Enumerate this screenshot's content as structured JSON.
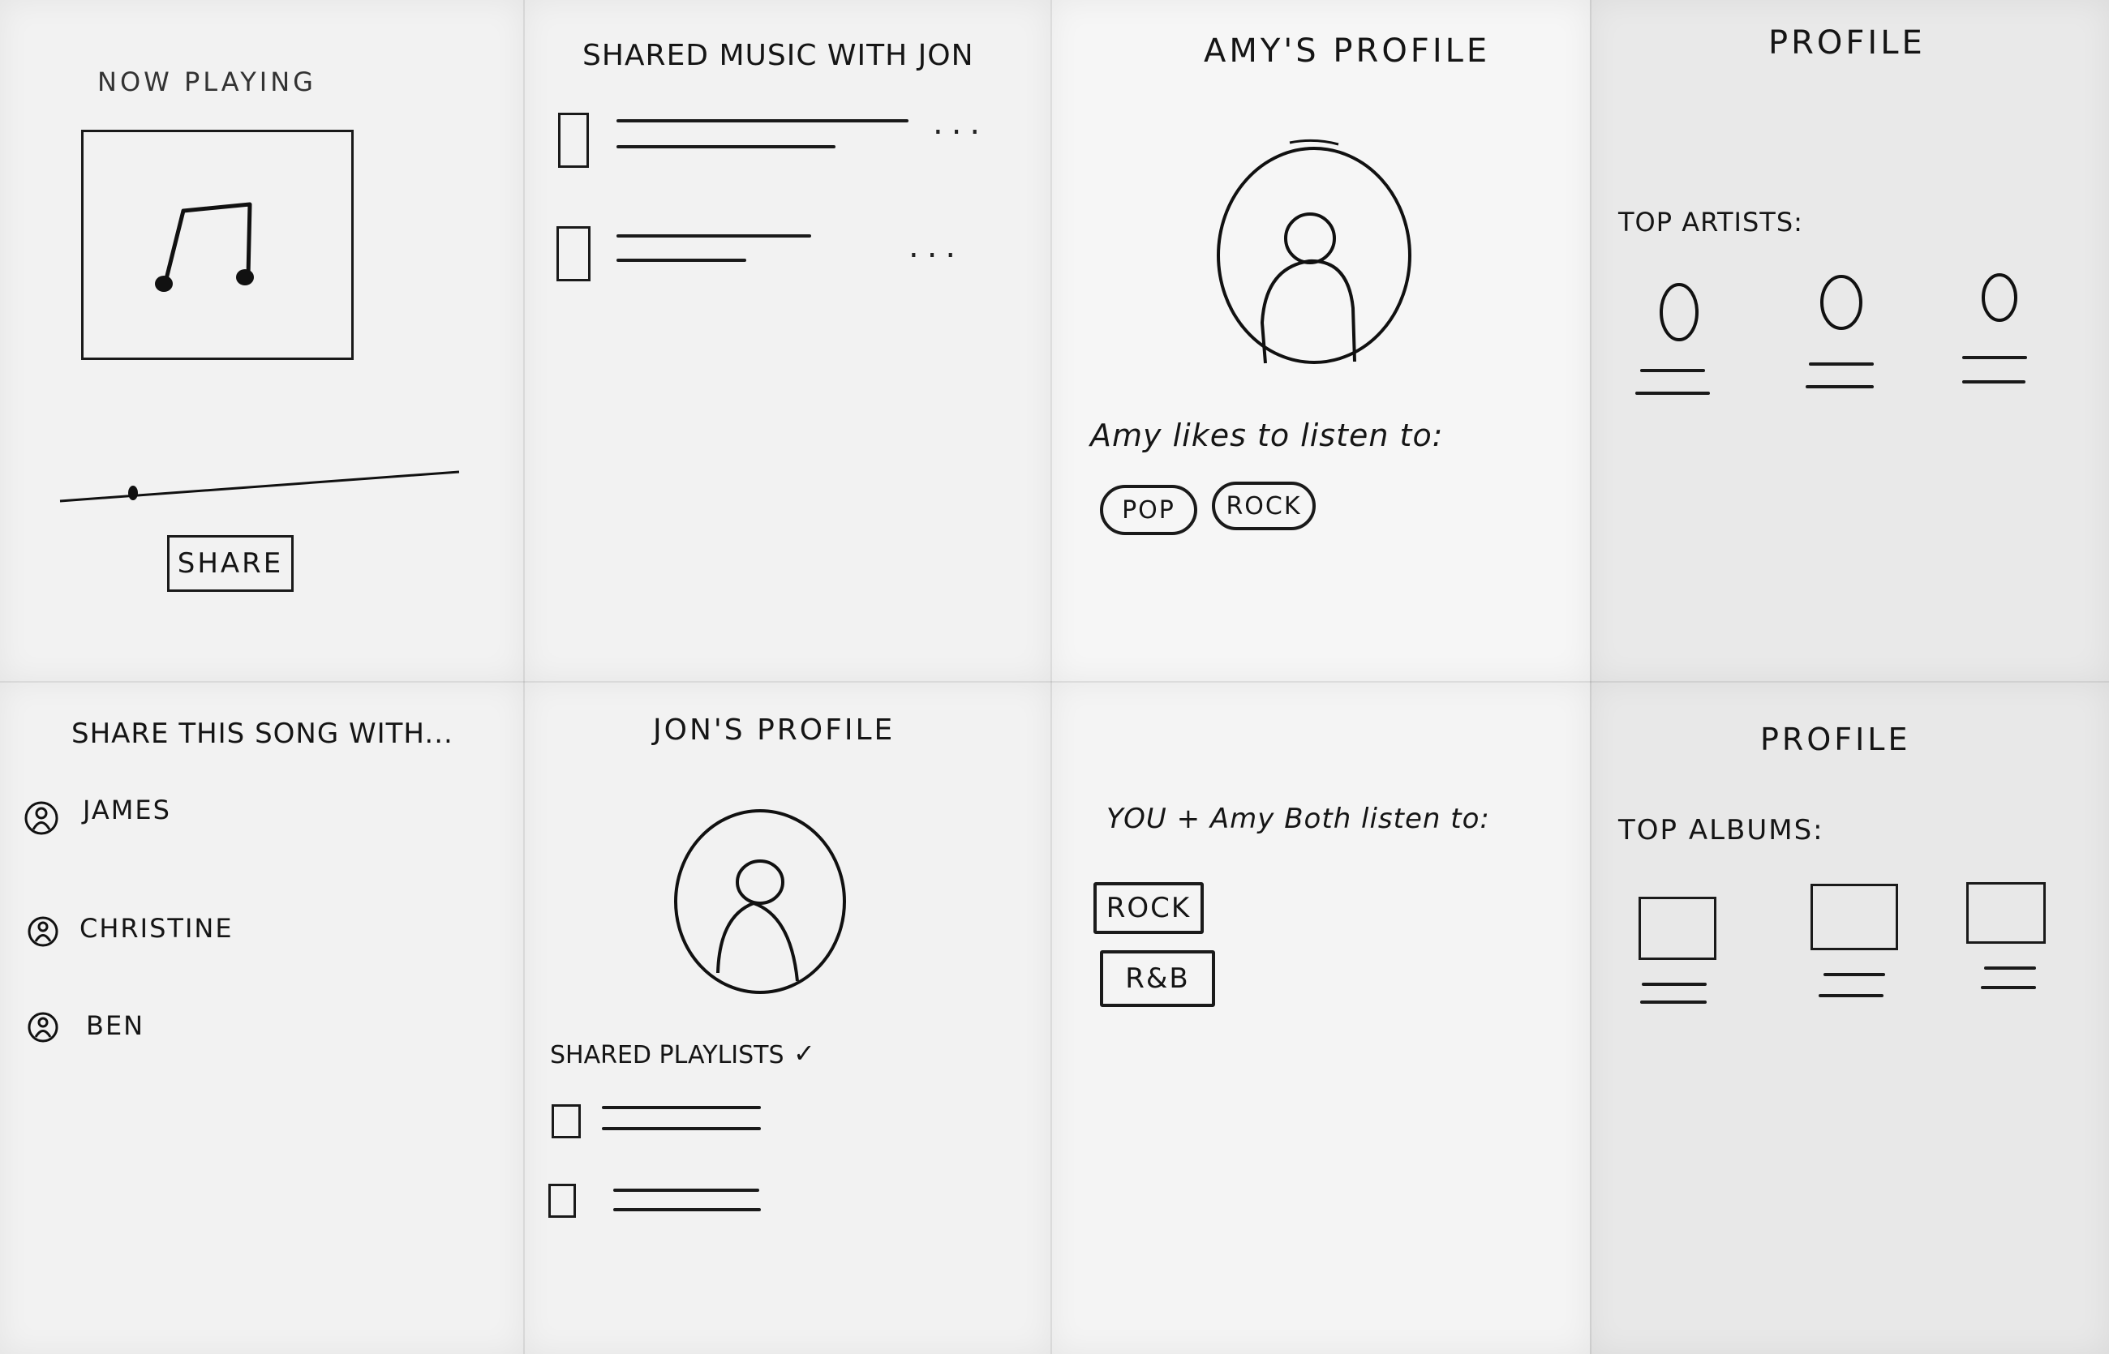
{
  "now_playing": {
    "title": "NOW PLAYING",
    "share_button": "SHARE",
    "icons": [
      "music-note-icon"
    ]
  },
  "shared_music": {
    "title": "SHARED MUSIC WITH JON",
    "items": [
      {
        "menu": "..."
      },
      {
        "menu": "..."
      }
    ]
  },
  "amys_profile": {
    "title": "AMY'S PROFILE",
    "likes_label": "Amy likes to listen to:",
    "genres": [
      "POP",
      "ROCK"
    ]
  },
  "profile_artists": {
    "title": "PROFILE",
    "section_label": "TOP ARTISTS:"
  },
  "share_with": {
    "title": "SHARE THIS SONG WITH...",
    "contacts": [
      "JAMES",
      "CHRISTINE",
      "BEN"
    ]
  },
  "jons_profile": {
    "title": "JON'S PROFILE",
    "playlists_label": "SHARED PLAYLISTS",
    "playlists_chevron": "✓"
  },
  "both_listen": {
    "label": "YOU + Amy Both listen to:",
    "genres": [
      "ROCK",
      "R&B"
    ]
  },
  "profile_albums": {
    "title": "PROFILE",
    "section_label": "TOP ALBUMS:"
  }
}
